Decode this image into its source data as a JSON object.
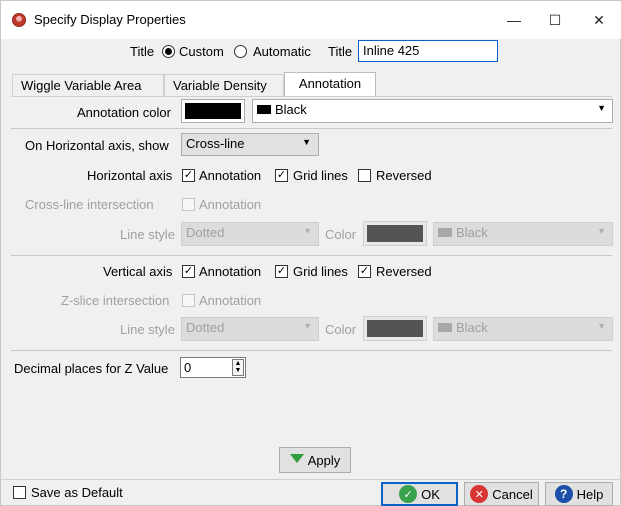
{
  "window": {
    "title": "Specify Display Properties",
    "minimize_glyph": "—",
    "maximize_glyph": "☐",
    "close_glyph": "✕"
  },
  "title_row": {
    "title_label": "Title",
    "custom_label": "Custom",
    "automatic_label": "Automatic",
    "title_field_label": "Title",
    "title_value": "Inline 425",
    "selected_mode": "Custom"
  },
  "tabs": [
    {
      "label": "Wiggle Variable Area"
    },
    {
      "label": "Variable Density"
    },
    {
      "label": "Annotation"
    }
  ],
  "active_tab": "Annotation",
  "annotation_color": {
    "label": "Annotation color",
    "swatch_color": "#000000",
    "value": "Black"
  },
  "horizontal_show": {
    "label": "On Horizontal axis, show",
    "value": "Cross-line"
  },
  "horizontal_axis": {
    "label": "Horizontal axis",
    "annotation_label": "Annotation",
    "annotation_checked": true,
    "grid_label": "Grid lines",
    "grid_checked": true,
    "reversed_label": "Reversed",
    "reversed_checked": false
  },
  "cross_line": {
    "label": "Cross-line intersection",
    "annotation_label": "Annotation",
    "line_style_label": "Line style",
    "line_style_value": "Dotted",
    "color_label": "Color",
    "swatch_color": "#545454",
    "color_value": "Black"
  },
  "vertical_axis": {
    "label": "Vertical axis",
    "annotation_label": "Annotation",
    "annotation_checked": true,
    "grid_label": "Grid lines",
    "grid_checked": true,
    "reversed_label": "Reversed",
    "reversed_checked": true
  },
  "z_slice": {
    "label": "Z-slice intersection",
    "annotation_label": "Annotation",
    "line_style_label": "Line style",
    "line_style_value": "Dotted",
    "color_label": "Color",
    "swatch_color": "#545454",
    "color_value": "Black"
  },
  "decimal_places": {
    "label": "Decimal places for Z Value",
    "value": "0"
  },
  "apply_label": "Apply",
  "footer": {
    "save_default_label": "Save as Default",
    "ok_label": "OK",
    "cancel_label": "Cancel",
    "help_label": "Help"
  },
  "colors": {
    "ok_icon": "#3aa24c",
    "cancel_icon": "#d93434",
    "help_icon": "#1c4fa8",
    "apply_arrow": "#2e9e3e",
    "focus_border": "#0a64c8"
  }
}
